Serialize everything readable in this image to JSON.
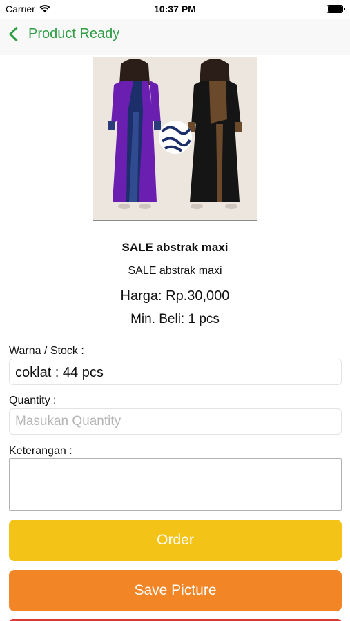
{
  "status_bar": {
    "carrier": "Carrier",
    "time": "10:37 PM"
  },
  "nav": {
    "back_label": "Product Ready",
    "accent": "#2f9e44"
  },
  "product": {
    "title": "SALE abstrak  maxi",
    "subtitle": "SALE abstrak  maxi",
    "price": "Harga: Rp.30,000",
    "min_buy": "Min. Beli: 1 pcs"
  },
  "form": {
    "color_stock_label": "Warna / Stock :",
    "color_stock_value": "coklat : 44 pcs",
    "quantity_label": "Quantity :",
    "quantity_placeholder": "Masukan Quantity",
    "quantity_value": "",
    "notes_label": "Keterangan :",
    "notes_value": ""
  },
  "buttons": {
    "order_label": "Order",
    "order_color": "#f3c318",
    "save_picture_label": "Save Picture",
    "save_picture_color": "#f28526"
  }
}
